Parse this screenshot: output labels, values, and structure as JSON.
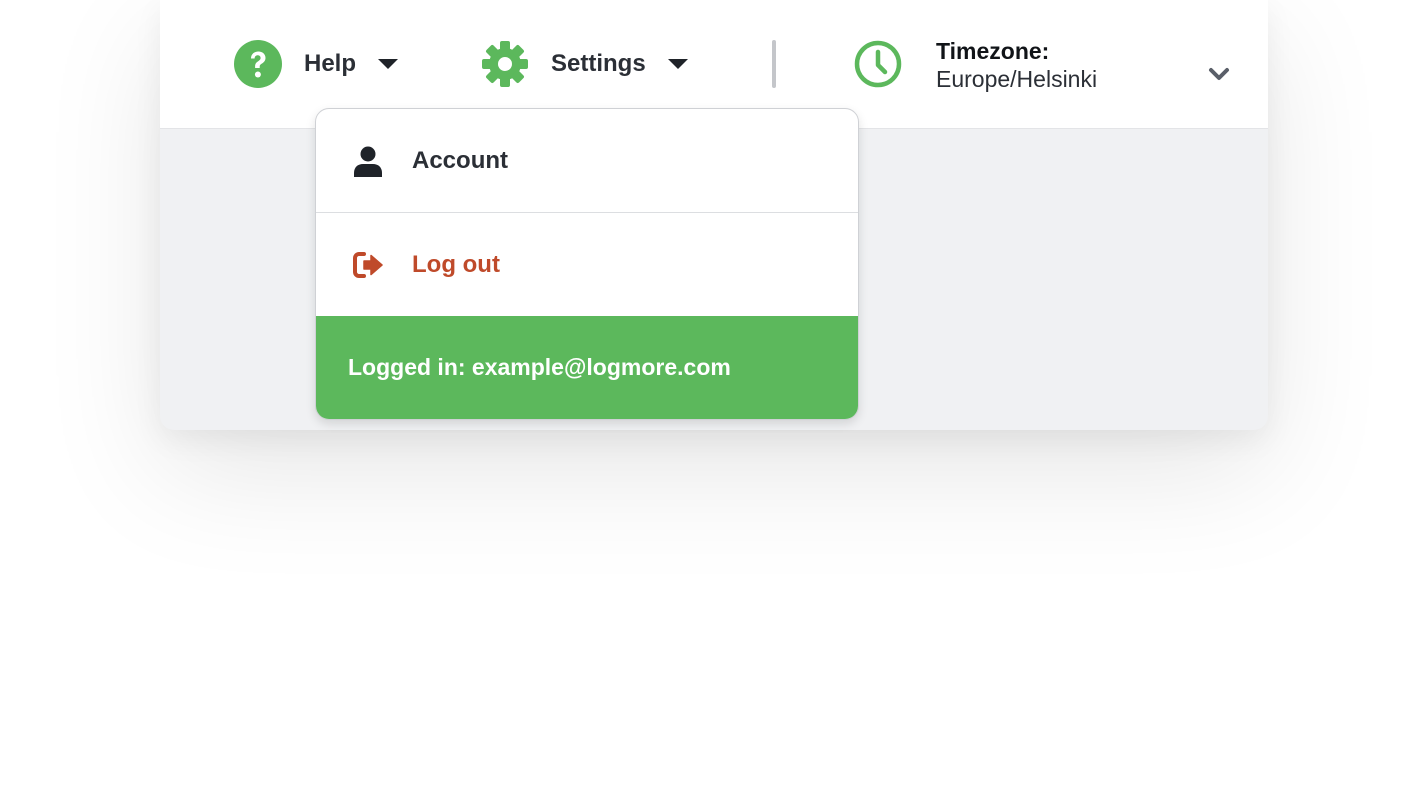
{
  "topbar": {
    "help": {
      "label": "Help",
      "icon": "question-circle-icon"
    },
    "settings": {
      "label": "Settings",
      "icon": "gear-icon"
    },
    "timezone": {
      "title": "Timezone:",
      "value": "Europe/Helsinki",
      "icon": "clock-icon"
    }
  },
  "dropdown": {
    "items": [
      {
        "label": "Account",
        "icon": "user-icon"
      },
      {
        "label": "Log out",
        "icon": "sign-out-icon"
      }
    ],
    "footer": "Logged in: example@logmore.com"
  },
  "colors": {
    "brand_green": "#5cb85c",
    "logout_red": "#bf4a2a",
    "text_dark": "#2b2f36",
    "background": "#f0f1f3"
  }
}
